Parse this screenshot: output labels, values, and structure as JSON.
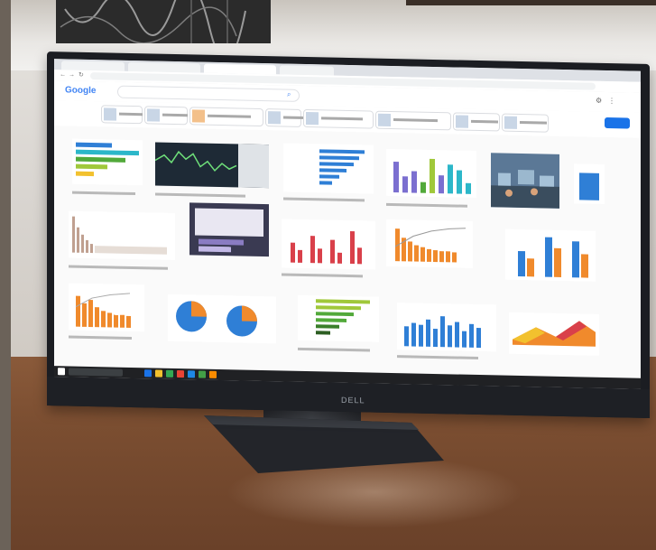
{
  "scene": {
    "description_free": true,
    "monitor_brand": "DELL",
    "colors": {
      "desk": "#7b4e31",
      "wall": "#dcd8d3",
      "bezel": "#1b1d22",
      "chart_blue": "#2f7fd6",
      "chart_orange": "#f08a2c",
      "chart_red": "#d9404a",
      "chart_green": "#52a93a",
      "chart_purple": "#7b6fd0",
      "google_blue": "#4285f4"
    }
  },
  "browser": {
    "search_logo": "Google"
  },
  "icons": [
    "back-icon",
    "forward-icon",
    "refresh-icon",
    "search-icon",
    "settings-icon",
    "apps-icon",
    "windows-start-icon",
    "taskbar-search-icon"
  ]
}
